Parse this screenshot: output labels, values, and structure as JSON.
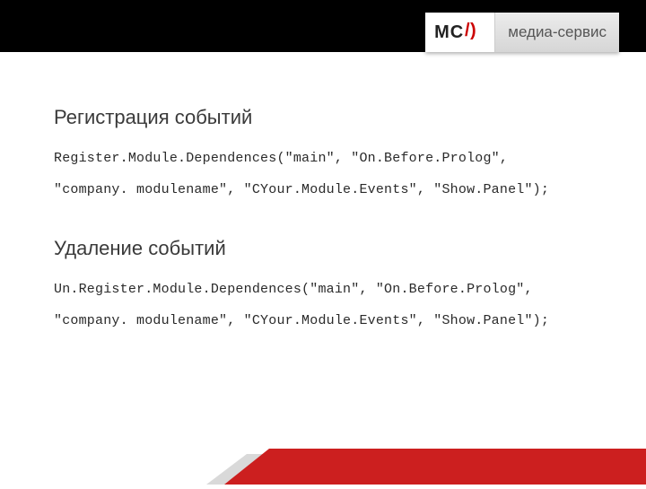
{
  "logo": {
    "mark_left": "M",
    "mark_mid": "C",
    "mark_tag": "медиа-сервис"
  },
  "section1": {
    "heading": "Регистрация событий",
    "line1": "Register.Module.Dependences(\"main\", \"On.Before.Prolog\",",
    "line2": "\"company. modulename\", \"CYour.Module.Events\", \"Show.Panel\");"
  },
  "section2": {
    "heading": "Удаление событий",
    "line1": "Un.Register.Module.Dependences(\"main\", \"On.Before.Prolog\",",
    "line2": "\"company. modulename\", \"CYour.Module.Events\", \"Show.Panel\");"
  }
}
